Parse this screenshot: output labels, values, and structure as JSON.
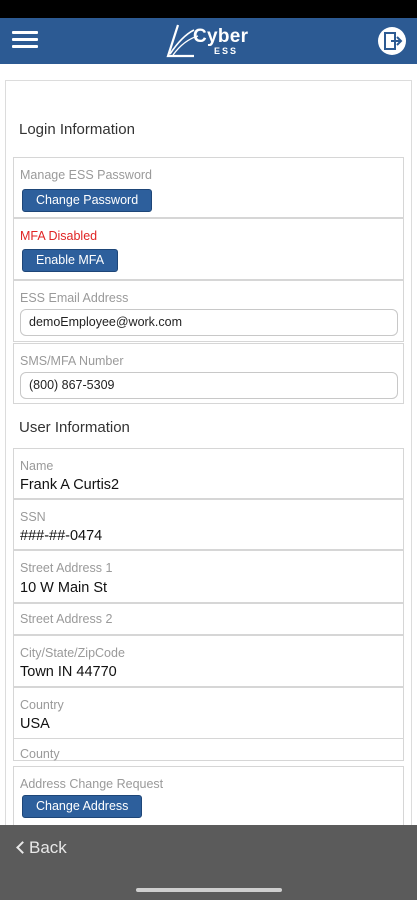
{
  "app": {
    "logo_text": "Cyber",
    "logo_sub": "ESS",
    "colors": {
      "header": "#2c5a93",
      "button": "#2d5f9c",
      "alert": "#e02424",
      "footer": "#5b5b5b"
    }
  },
  "login": {
    "title": "Login Information",
    "password_label": "Manage ESS Password",
    "change_password": "Change Password",
    "mfa_status": "MFA Disabled",
    "enable_mfa": "Enable MFA",
    "email_label": "ESS Email Address",
    "email_value": "demoEmployee@work.com",
    "sms_label": "SMS/MFA Number",
    "sms_value": "(800) 867-5309"
  },
  "user": {
    "title": "User Information",
    "name_label": "Name",
    "name_value": "Frank  A  Curtis2",
    "ssn_label": "SSN",
    "ssn_value": "###-##-0474",
    "street1_label": "Street Address 1",
    "street1_value": "10 W Main St",
    "street2_label": "Street Address 2",
    "city_label": "City/State/ZipCode",
    "city_value": "Town  IN  44770",
    "country_label": "Country",
    "country_value": "USA",
    "county_label": "County",
    "address_change_label": "Address Change Request",
    "change_address": "Change Address"
  },
  "footer": {
    "back": "Back"
  }
}
